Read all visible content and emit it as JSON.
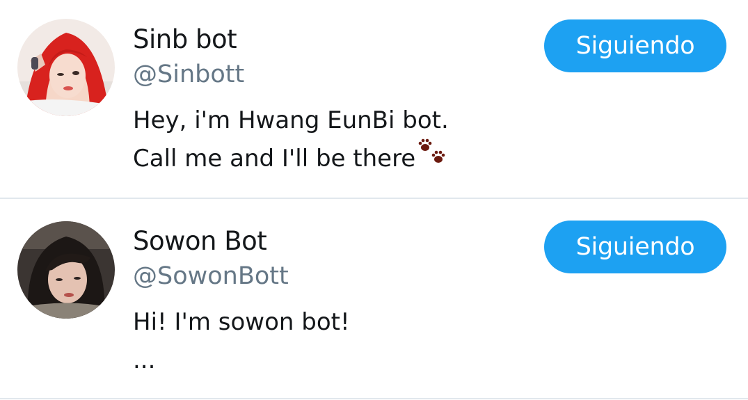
{
  "accounts": [
    {
      "display_name": "Sinb bot",
      "handle": "@Sinbott",
      "bio_lines": [
        "Hey, i'm Hwang EunBi bot.",
        "Call me and I'll be there"
      ],
      "bio_emoji": "paw-prints-icon",
      "follow_label": "Siguiendo"
    },
    {
      "display_name": "Sowon Bot",
      "handle": "@SowonBott",
      "bio_lines": [
        "Hi! I'm sowon bot!",
        "..."
      ],
      "follow_label": "Siguiendo"
    }
  ],
  "colors": {
    "accent": "#1da1f2",
    "text_primary": "#14171a",
    "text_secondary": "#657786",
    "divider": "#e1e8ed",
    "paw": "#6b1a0f"
  }
}
